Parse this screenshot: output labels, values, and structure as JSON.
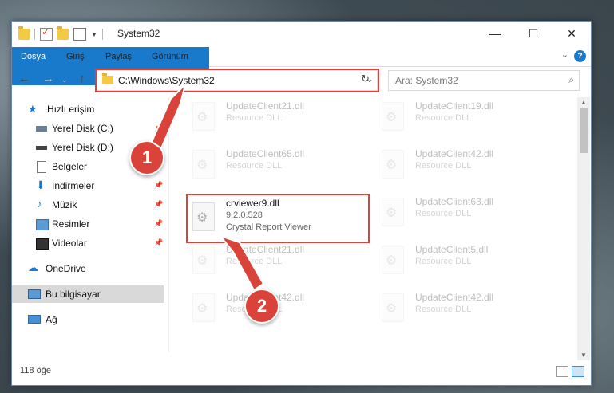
{
  "window": {
    "title": "System32"
  },
  "ribbon": {
    "tabs": [
      "Dosya",
      "Giriş",
      "Paylaş",
      "Görünüm"
    ],
    "help": "?"
  },
  "address": {
    "path": "C:\\Windows\\System32",
    "search_placeholder": "Ara: System32"
  },
  "sidebar": {
    "items": [
      {
        "label": "Hızlı erişim",
        "icon": "star-icon"
      },
      {
        "label": "Yerel Disk (C:)",
        "icon": "drive-icon"
      },
      {
        "label": "Yerel Disk (D:)",
        "icon": "drive-icon"
      },
      {
        "label": "Belgeler",
        "icon": "document-icon"
      },
      {
        "label": "İndirmeler",
        "icon": "download-icon"
      },
      {
        "label": "Müzik",
        "icon": "music-icon"
      },
      {
        "label": "Resimler",
        "icon": "pictures-icon"
      },
      {
        "label": "Videolar",
        "icon": "video-icon"
      },
      {
        "label": "OneDrive",
        "icon": "cloud-icon"
      },
      {
        "label": "Bu bilgisayar",
        "icon": "computer-icon"
      },
      {
        "label": "Ağ",
        "icon": "network-icon"
      }
    ]
  },
  "files": [
    {
      "name": "UpdateClient21.dll",
      "desc": "Resource DLL"
    },
    {
      "name": "UpdateClient19.dll",
      "desc": "Resource DLL"
    },
    {
      "name": "UpdateClient65.dll",
      "desc": "Resource DLL"
    },
    {
      "name": "UpdateClient42.dll",
      "desc": "Resource DLL"
    },
    {
      "name": "crviewer9.dll",
      "version": "9.2.0.528",
      "desc": "Crystal Report Viewer"
    },
    {
      "name": "UpdateClient63.dll",
      "desc": "Resource DLL"
    },
    {
      "name": "UpdateClient21.dll",
      "desc": "Resource DLL"
    },
    {
      "name": "UpdateClient5.dll",
      "desc": "Resource DLL"
    },
    {
      "name": "UpdateClient42.dll",
      "desc": "Resource DLL"
    },
    {
      "name": "UpdateClient42.dll",
      "desc": "Resource DLL"
    }
  ],
  "status": {
    "count": "118 öğe"
  },
  "callouts": [
    "1",
    "2"
  ],
  "colors": {
    "accent": "#1979ca",
    "highlight": "#d9433a"
  }
}
